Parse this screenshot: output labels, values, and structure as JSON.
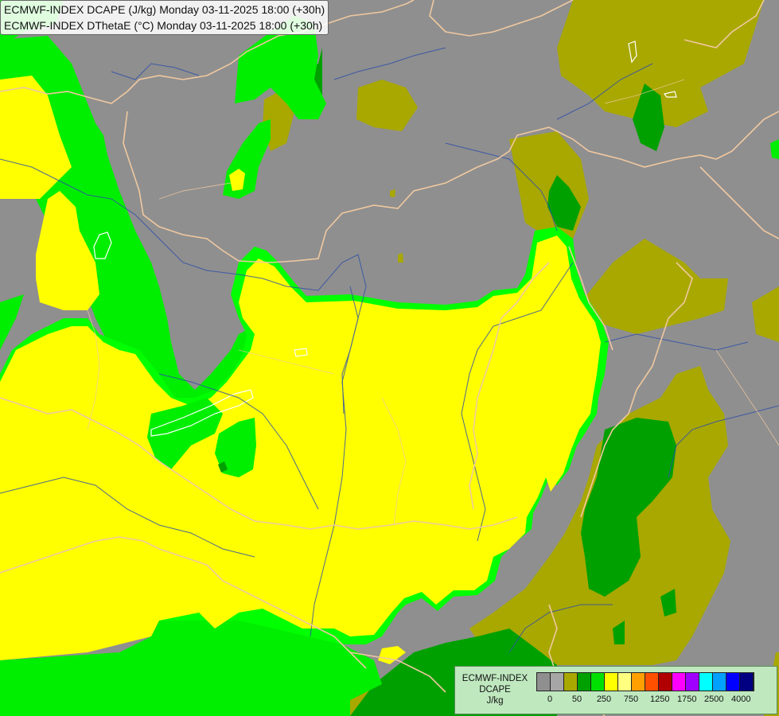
{
  "header": {
    "line1": "ECMWF-INDEX DCAPE (J/kg) Monday 03-11-2025 18:00 (+30h)",
    "line2": "ECMWF-INDEX DThetaE (°C) Monday 03-11-2025 18:00 (+30h)"
  },
  "legend": {
    "line1": "ECMWF-INDEX",
    "line2": "DCAPE",
    "line3": "J/kg",
    "colors": [
      "#8f8f8f",
      "#a6a6a6",
      "#a8a800",
      "#00a000",
      "#00e000",
      "#ffff00",
      "#ffff80",
      "#ffa000",
      "#ff5000",
      "#b00000",
      "#ff00ff",
      "#a000ff",
      "#00ffff",
      "#00a0ff",
      "#0000ff",
      "#000080"
    ],
    "tick_labels": [
      "0",
      "50",
      "250",
      "750",
      "1250",
      "1750",
      "2500",
      "4000"
    ]
  },
  "palette": {
    "gray": "#8f8f8f",
    "olive": "#a8a800",
    "dark_green": "#00a000",
    "green": "#00e000",
    "light_green": "#00ff00",
    "yellow": "#ffff00",
    "borders": "#f0c8a0",
    "rivers": "#3050a8",
    "lakes": "#ffffff"
  }
}
